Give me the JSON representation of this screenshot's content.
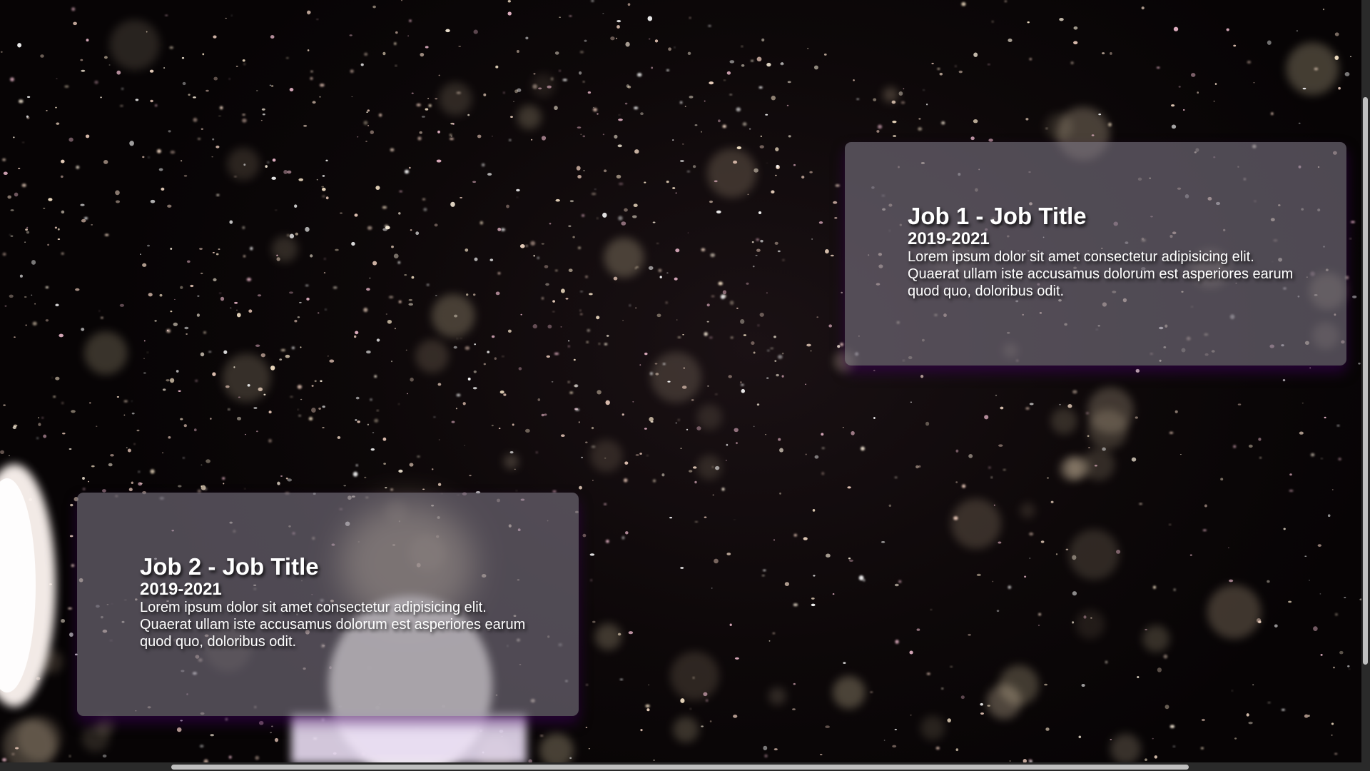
{
  "jobs": [
    {
      "title": "Job 1 - Job Title",
      "years": "2019-2021",
      "description": "Lorem ipsum dolor sit amet consectetur adipisicing elit. Quaerat ullam iste accusamus dolorum est asperiores earum quod quo, doloribus odit."
    },
    {
      "title": "Job 2 - Job Title",
      "years": "2019-2021",
      "description": "Lorem ipsum dolor sit amet consectetur adipisicing elit. Quaerat ullam iste accusamus dolorum est asperiores earum quod quo, doloribus odit."
    }
  ],
  "colors": {
    "card_background": "#7a7582",
    "card_shadow": "#3c005a",
    "background": "#0c0708",
    "text": "#ffffff",
    "scrollbar_track": "#2a2a2a",
    "scrollbar_thumb": "#bfbfbf"
  }
}
